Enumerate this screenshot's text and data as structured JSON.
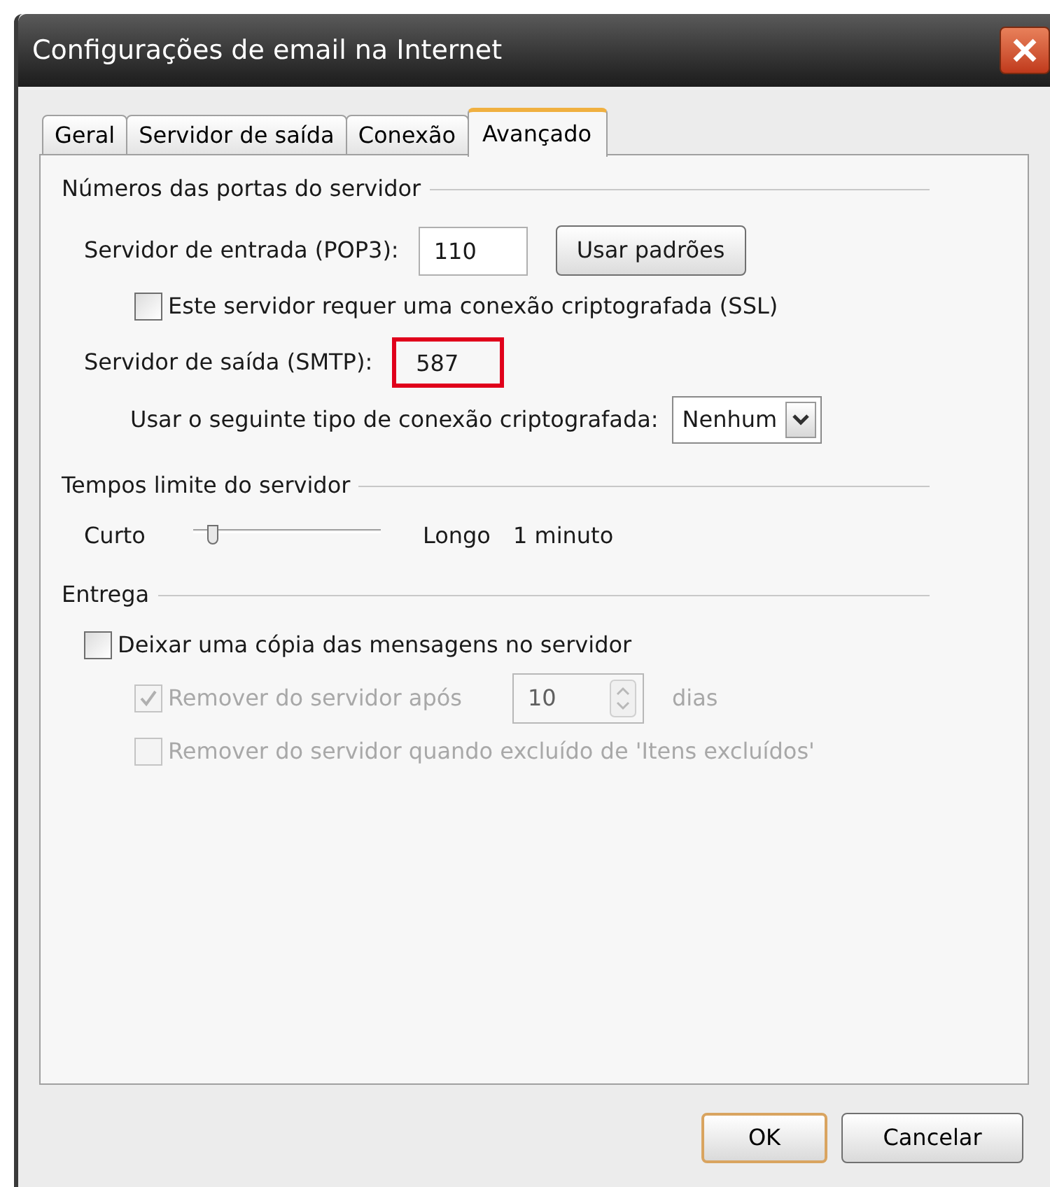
{
  "window": {
    "title": "Configurações de email na Internet"
  },
  "tabs": [
    {
      "label": "Geral",
      "selected": false
    },
    {
      "label": "Servidor de saída",
      "selected": false
    },
    {
      "label": "Conexão",
      "selected": false
    },
    {
      "label": "Avançado",
      "selected": true
    }
  ],
  "ports": {
    "heading": "Números das portas do servidor",
    "incoming": {
      "label": "Servidor de entrada (POP3):",
      "value": "110"
    },
    "defaults_button": "Usar padrões",
    "ssl": {
      "label": "Este servidor requer uma conexão criptografada (SSL)",
      "checked": false
    },
    "outgoing": {
      "label": "Servidor de saída (SMTP):",
      "value": "587",
      "highlighted": true
    },
    "encryption": {
      "label": "Usar o seguinte tipo de conexão criptografada:",
      "value": "Nenhum"
    }
  },
  "timeouts": {
    "heading": "Tempos limite do servidor",
    "min_label": "Curto",
    "max_label": "Longo",
    "level": 0.08,
    "reading": "1 minuto"
  },
  "delivery": {
    "heading": "Entrega",
    "leave_copy": {
      "label": "Deixar uma cópia das mensagens no servidor",
      "checked": false,
      "disabled": false
    },
    "remove_after": {
      "label": "Remover do servidor após",
      "checked": true,
      "disabled": true,
      "value": "10",
      "unit": "dias"
    },
    "remove_deleted": {
      "label": "Remover do servidor quando excluído de 'Itens excluídos'",
      "checked": false,
      "disabled": true
    }
  },
  "buttons": [
    {
      "label": "OK",
      "default": true
    },
    {
      "label": "Cancelar",
      "default": false
    }
  ]
}
